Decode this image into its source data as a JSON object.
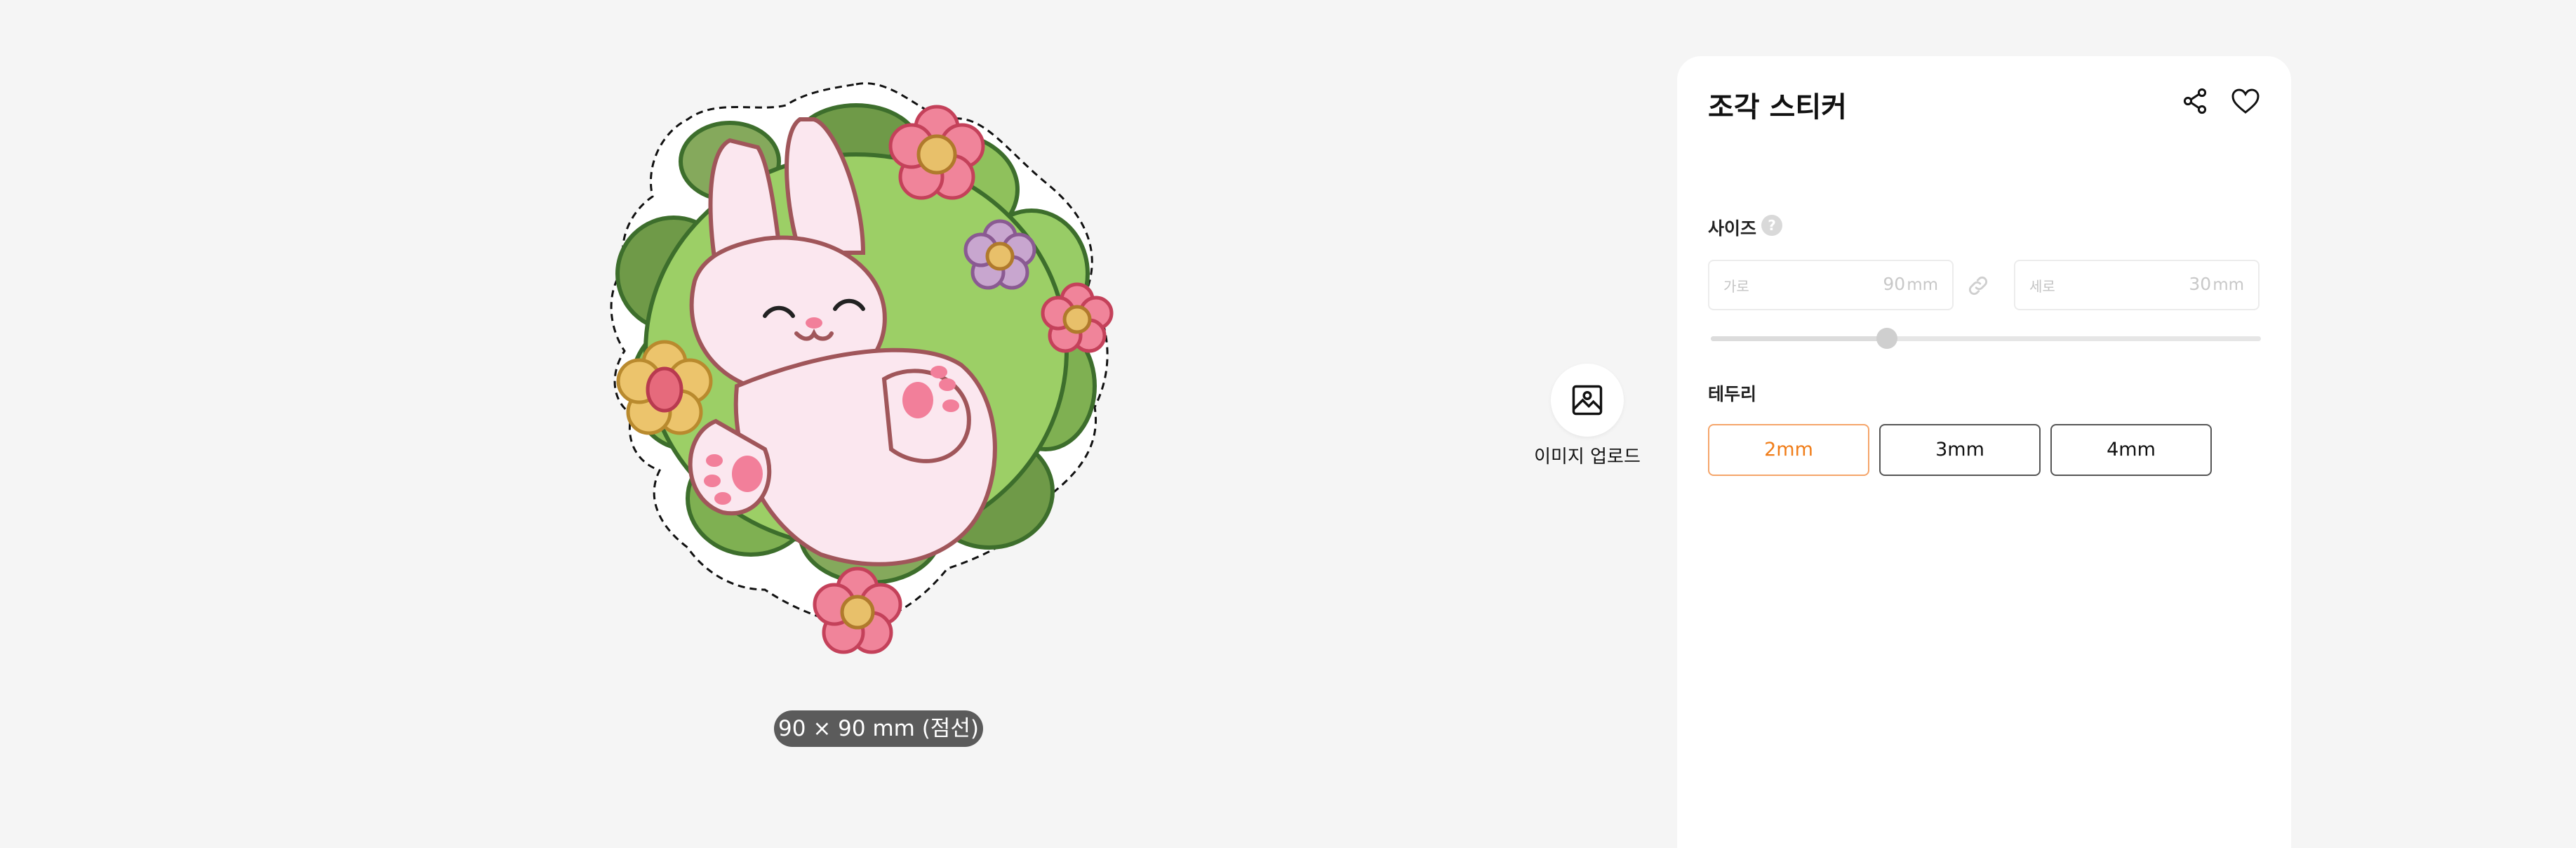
{
  "preview": {
    "size_caption": "90 × 90 mm (점선)"
  },
  "upload": {
    "label": "이미지 업로드",
    "icon": "image-icon"
  },
  "panel": {
    "title": "조각 스티커",
    "actions": [
      {
        "name": "share",
        "icon": "share-icon"
      },
      {
        "name": "favorite",
        "icon": "heart-icon"
      }
    ],
    "size": {
      "label": "사이즈",
      "help_icon": "?",
      "width": {
        "label": "가로",
        "value": "90",
        "unit": "mm"
      },
      "height": {
        "label": "세로",
        "value": "30",
        "unit": "mm"
      },
      "link_icon": "link-icon",
      "slider_value": 0.32
    },
    "border": {
      "label": "테두리",
      "options": [
        "2mm",
        "3mm",
        "4mm"
      ],
      "selected": "2mm"
    }
  },
  "colors": {
    "background": "#f5f5f5",
    "accent": "#f07d19",
    "accent_border": "#f5a56a",
    "pill_bg": "#5b5b5b"
  }
}
